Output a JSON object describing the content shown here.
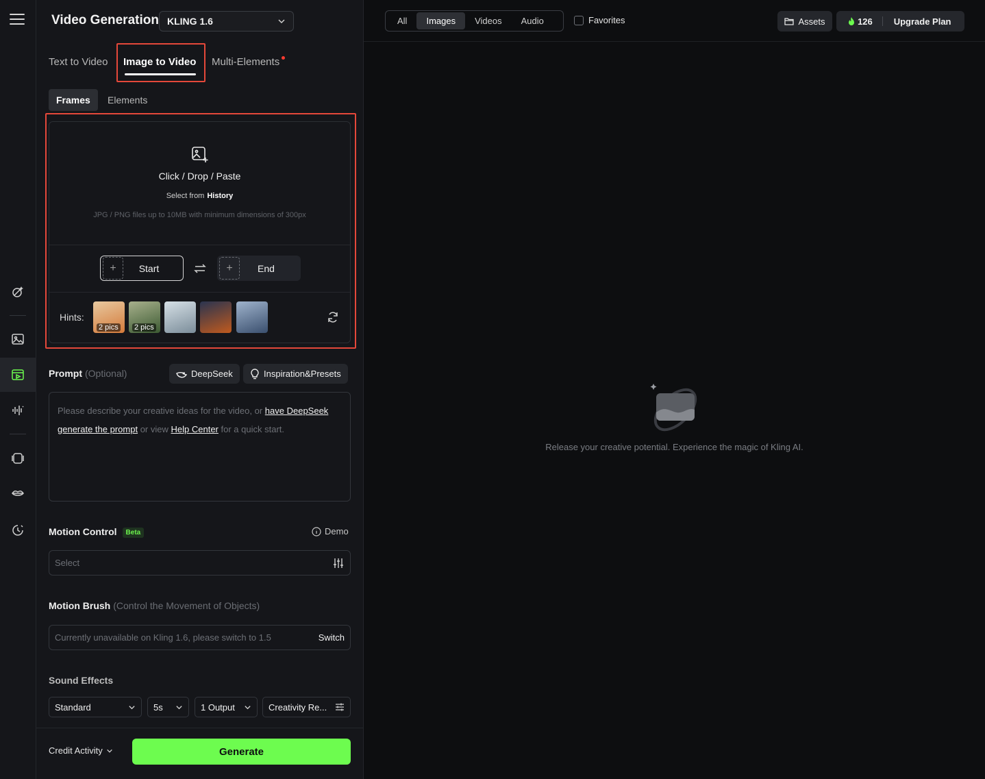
{
  "sidebar": {
    "icons": [
      "menu-icon",
      "sparkle-brush-icon",
      "image-icon",
      "video-icon",
      "audio-wave-icon",
      "frame-icon",
      "lips-icon",
      "history-icon"
    ]
  },
  "header": {
    "title": "Video Generation",
    "model": "KLING 1.6"
  },
  "mode_tabs": [
    {
      "label": "Text to Video",
      "active": false
    },
    {
      "label": "Image to Video",
      "active": true
    },
    {
      "label": "Multi-Elements",
      "active": false
    }
  ],
  "sub_tabs": [
    {
      "label": "Frames",
      "active": true
    },
    {
      "label": "Elements",
      "active": false
    }
  ],
  "upload": {
    "title": "Click / Drop / Paste",
    "history_prefix": "Select from",
    "history_link": "History",
    "note": "JPG / PNG files up to 10MB with minimum dimensions of 300px",
    "start_label": "Start",
    "end_label": "End",
    "hints_label": "Hints:",
    "hints": [
      {
        "badge": "2 pics",
        "colors": [
          "#d47a3a",
          "#e8c9a0"
        ]
      },
      {
        "badge": "2 pics",
        "colors": [
          "#3c5a32",
          "#a7b08c"
        ]
      },
      {
        "badge": "",
        "colors": [
          "#7b8d9a",
          "#d6e0e6"
        ]
      },
      {
        "badge": "",
        "colors": [
          "#c05a1e",
          "#2a3450"
        ]
      },
      {
        "badge": "",
        "colors": [
          "#3a4f6e",
          "#9fb3cc"
        ]
      }
    ]
  },
  "prompt": {
    "label": "Prompt",
    "optional": "(Optional)",
    "deepseek_btn": "DeepSeek",
    "inspiration_btn": "Inspiration&Presets",
    "placeholder_1": "Please describe your creative ideas for the video, or",
    "link_1": "have DeepSeek",
    "link_2": "generate the prompt",
    "placeholder_2": "or view",
    "link_3": "Help Center",
    "placeholder_3": "for a quick start."
  },
  "motion_control": {
    "label": "Motion Control",
    "badge": "Beta",
    "demo": "Demo",
    "select_placeholder": "Select"
  },
  "motion_brush": {
    "label": "Motion Brush",
    "hint": "(Control the Movement of Objects)",
    "unavailable": "Currently unavailable on Kling 1.6, please switch to 1.5",
    "switch": "Switch"
  },
  "sound_effects": {
    "label": "Sound Effects"
  },
  "settings": {
    "mode": "Standard",
    "duration": "5s",
    "outputs": "1 Output",
    "creativity": "Creativity Re..."
  },
  "footer": {
    "credit_activity": "Credit Activity",
    "generate": "Generate"
  },
  "topbar": {
    "filters": [
      {
        "label": "All",
        "active": false
      },
      {
        "label": "Images",
        "active": true
      },
      {
        "label": "Videos",
        "active": false
      },
      {
        "label": "Audio",
        "active": false
      }
    ],
    "favorites": "Favorites",
    "assets": "Assets",
    "credits": "126",
    "upgrade": "Upgrade Plan"
  },
  "empty_state": {
    "text": "Release your creative potential. Experience the magic of Kling AI."
  },
  "colors": {
    "accent": "#6dfc4f",
    "highlight_box": "#e5483a"
  }
}
